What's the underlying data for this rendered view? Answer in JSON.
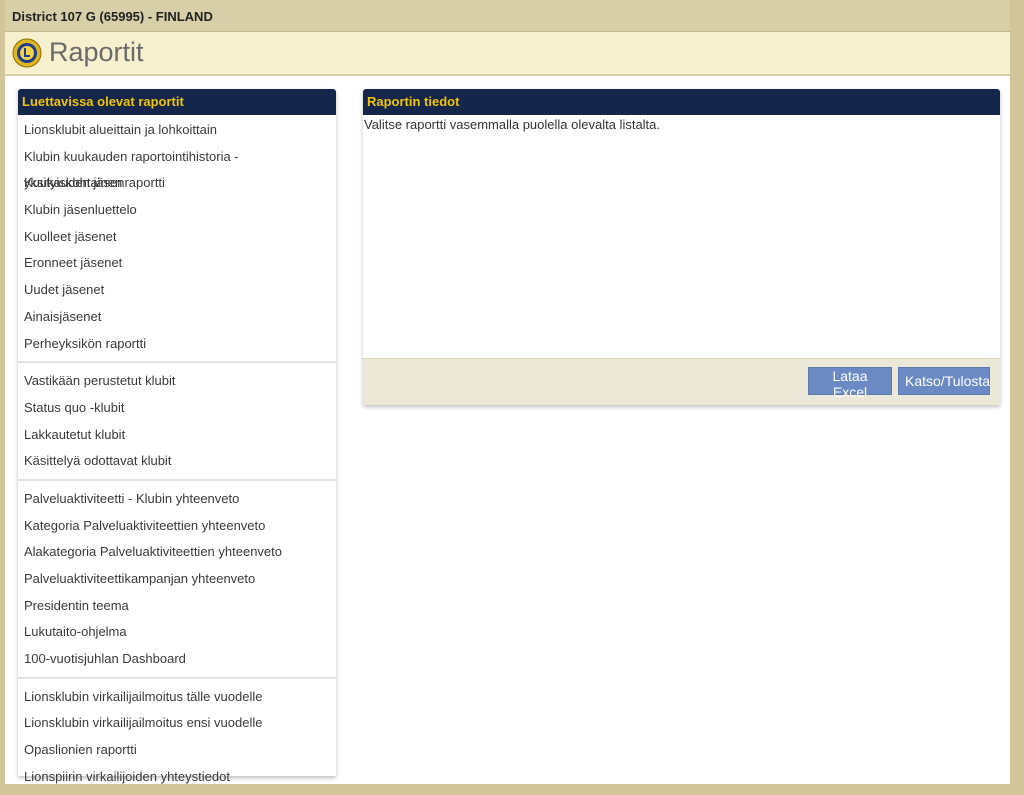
{
  "topbar": {
    "title": "District 107 G (65995) - FINLAND"
  },
  "header": {
    "title": "Raportit",
    "logo_icon": "lions-logo-icon"
  },
  "left_panel": {
    "heading": "Luettavissa olevat raportit",
    "groups": [
      {
        "items": [
          "Lionsklubit alueittain ja lohkoittain",
          "Klubin kuukauden raportointihistoria - yksityiskohtainen",
          "Kuukauden jäsenraportti",
          "Klubin jäsenluettelo",
          "Kuolleet jäsenet",
          "Eronneet jäsenet",
          "Uudet jäsenet",
          "Ainaisjäsenet",
          "Perheyksikön raportti"
        ]
      },
      {
        "items": [
          "Vastikään perustetut klubit",
          "Status quo -klubit",
          "Lakkautetut klubit",
          "Käsittelyä odottavat klubit"
        ]
      },
      {
        "items": [
          "Palveluaktiviteetti - Klubin yhteenveto",
          "Kategoria Palveluaktiviteettien yhteenveto",
          "Alakategoria Palveluaktiviteettien yhteenveto",
          "Palveluaktiviteettikampanjan yhteenveto",
          "Presidentin teema",
          "Lukutaito-ohjelma",
          "100-vuotisjuhlan Dashboard"
        ]
      },
      {
        "items": [
          "Lionsklubin virkailijailmoitus tälle vuodelle",
          "Lionsklubin virkailijailmoitus ensi vuodelle",
          "Opaslionien raportti",
          "Lionspiirin virkailijoiden yhteystiedot"
        ]
      }
    ]
  },
  "right_panel": {
    "heading": "Raportin tiedot",
    "text": "Valitse raportti vasemmalla puolella olevalta listalta.",
    "buttons": {
      "excel": "Lataa Excel",
      "print": "Katso/Tulosta"
    }
  },
  "colors": {
    "panel_header_bg": "#14264a",
    "panel_header_text": "#f2c400",
    "button_bg": "#6b8ac3",
    "header_bg": "#f6f0cf",
    "topbar_bg": "#d6cfa7"
  }
}
